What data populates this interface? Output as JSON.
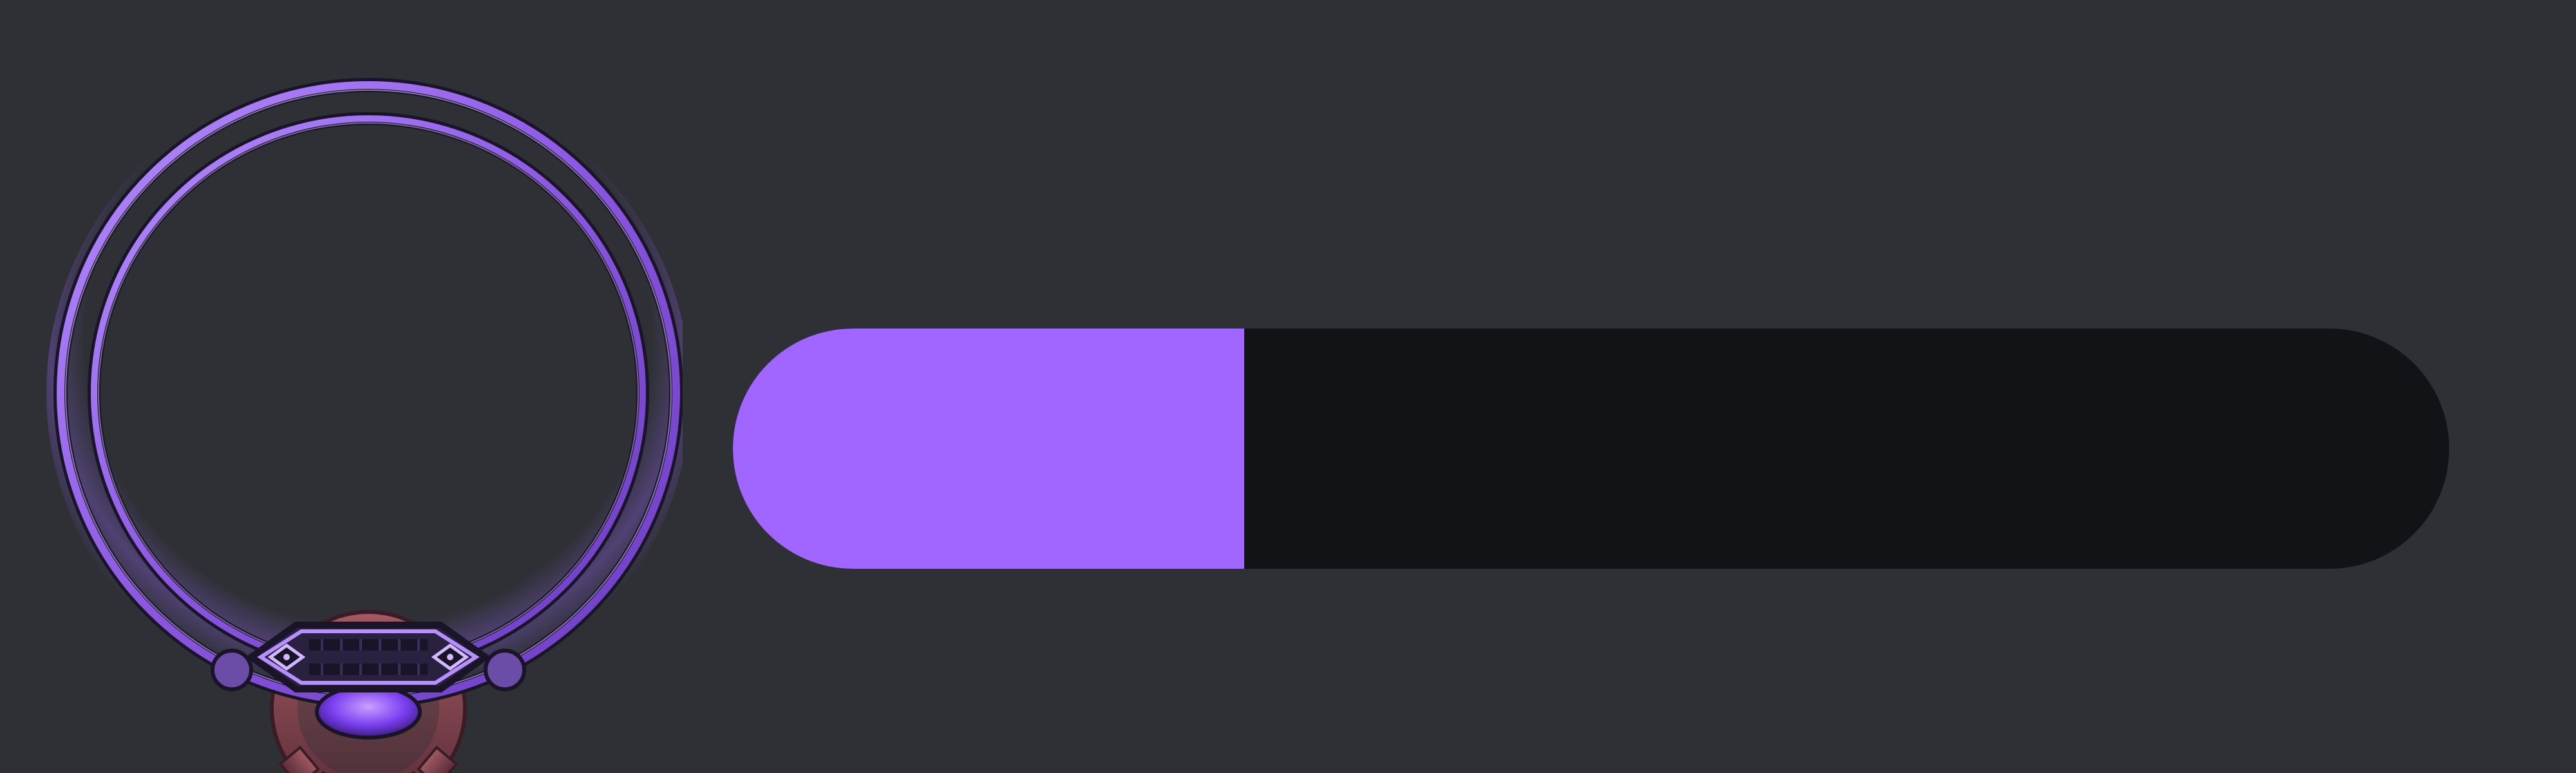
{
  "avatar_frame": {
    "icon": "avatar-frame-purple-ring-icon",
    "ring_color": "#9b63e8",
    "ring_dark_color": "#1a1428",
    "gem_color": "#7b3ff0",
    "gear_color": "#8a4a55"
  },
  "progress_bar": {
    "progress": 0.298,
    "fill_color": "#a066ff",
    "track_color": "#111316"
  },
  "colors": {
    "background": "#2e3035"
  }
}
